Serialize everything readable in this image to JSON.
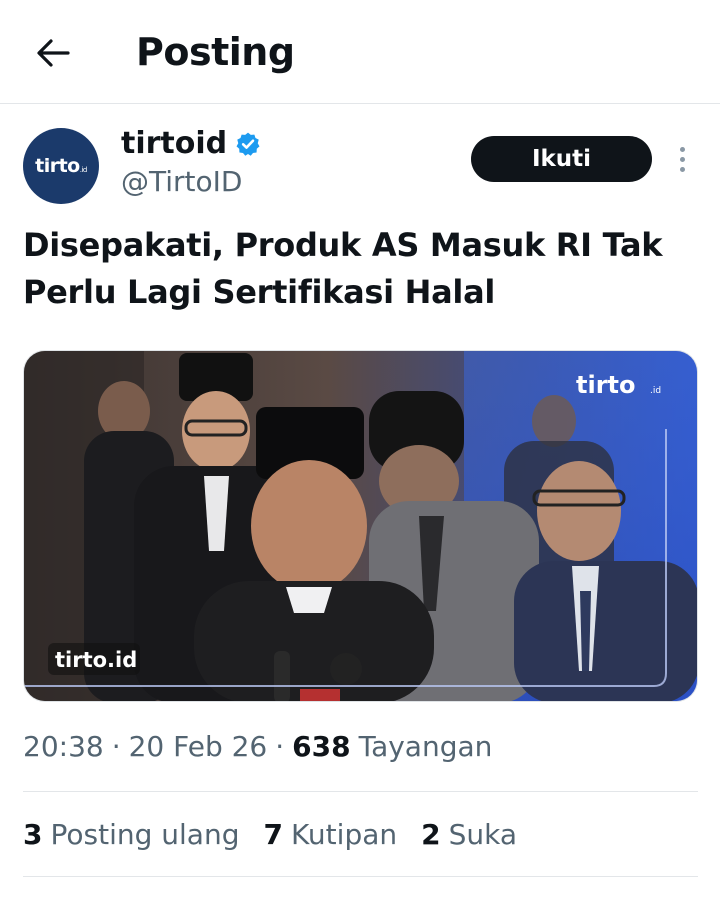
{
  "header": {
    "title": "Posting"
  },
  "author": {
    "display_name": "tirtoid",
    "handle": "@TirtoID",
    "avatar_text": "tirto",
    "avatar_suffix": ".id",
    "verified_icon": "verified-badge-icon",
    "verified_color": "#1d9bf0",
    "follow_label": "Ikuti"
  },
  "post": {
    "text": "Disepakati, Produk AS Masuk RI Tak Perlu Lagi Sertifikasi Halal",
    "media": {
      "logo_top": "tirto",
      "logo_top_suffix": ".id",
      "logo_bottom": "tirto.id"
    },
    "time": "20:38",
    "date": "20 Feb 26",
    "views": "638",
    "views_label": "Tayangan"
  },
  "stats": {
    "reposts": "3",
    "reposts_label": "Posting ulang",
    "quotes": "7",
    "quotes_label": "Kutipan",
    "likes": "2",
    "likes_label": "Suka"
  },
  "colors": {
    "text": "#0f1419",
    "secondary": "#536471",
    "divider": "#e3e6e9",
    "brand": "#1b3a6b"
  }
}
